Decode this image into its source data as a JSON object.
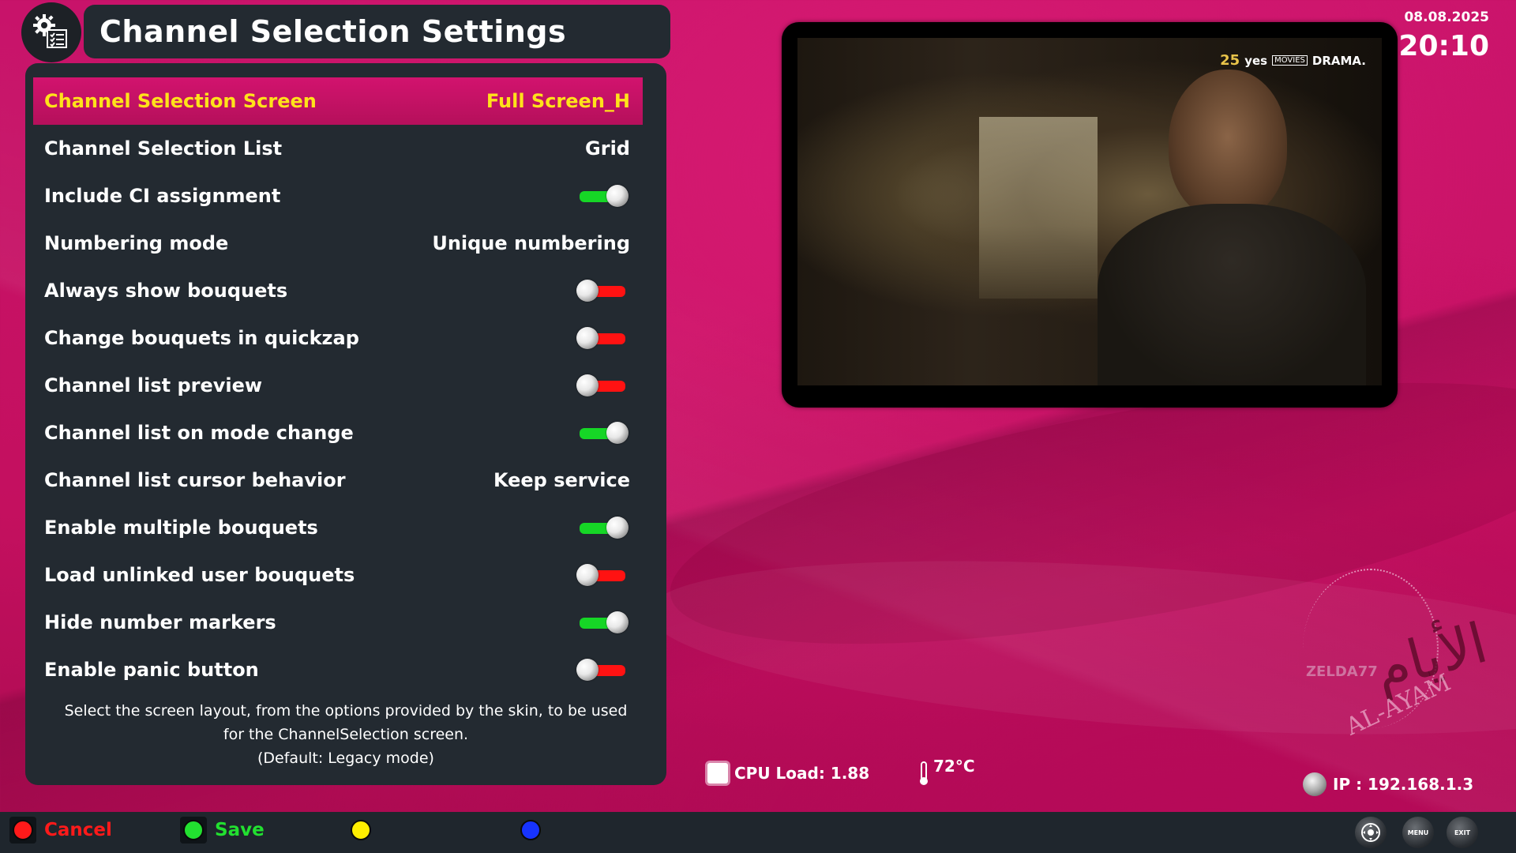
{
  "header": {
    "title": "Channel Selection Settings",
    "icon": "settings-gear-list-icon"
  },
  "settings": [
    {
      "label": "Channel Selection Screen",
      "value": "Full Screen_H",
      "type": "text",
      "selected": true
    },
    {
      "label": "Channel Selection List",
      "value": "Grid",
      "type": "text"
    },
    {
      "label": "Include CI assignment",
      "value": "on",
      "type": "toggle"
    },
    {
      "label": "Numbering mode",
      "value": "Unique numbering",
      "type": "text"
    },
    {
      "label": "Always show bouquets",
      "value": "off",
      "type": "toggle"
    },
    {
      "label": "Change bouquets in quickzap",
      "value": "off",
      "type": "toggle"
    },
    {
      "label": "Channel list preview",
      "value": "off",
      "type": "toggle"
    },
    {
      "label": "Channel list on mode change",
      "value": "on",
      "type": "toggle"
    },
    {
      "label": "Channel list cursor behavior",
      "value": "Keep service",
      "type": "text"
    },
    {
      "label": "Enable multiple bouquets",
      "value": "on",
      "type": "toggle"
    },
    {
      "label": "Load unlinked user bouquets",
      "value": "off",
      "type": "toggle"
    },
    {
      "label": "Hide number markers",
      "value": "on",
      "type": "toggle"
    },
    {
      "label": "Enable panic button",
      "value": "off",
      "type": "toggle"
    }
  ],
  "description": {
    "line1": "Select the screen layout, from the options provided by the skin, to be used",
    "line2": "for the ChannelSelection screen.",
    "line3": "(Default: Legacy mode)"
  },
  "preview": {
    "channel_logo": {
      "num": "25",
      "brand": "yes",
      "box": "MOVIES",
      "name": "DRAMA."
    }
  },
  "clock": {
    "date": "08.08.2025",
    "time": "20:10"
  },
  "watermark": {
    "author": "ZELDA77",
    "brand": "AL-AYAM",
    "arabic": "الأيام"
  },
  "system": {
    "cpu": "CPU Load: 1.88",
    "temperature": "72°C",
    "ip": "IP : 192.168.1.3"
  },
  "buttons": {
    "red": {
      "label": "Cancel",
      "color": "#ff1a1a"
    },
    "green": {
      "label": "Save",
      "color": "#22e030"
    },
    "yellow": {
      "label": "",
      "color": "#ffee00"
    },
    "blue": {
      "label": "",
      "color": "#1733ff"
    },
    "menu": "MENU",
    "exit": "EXIT"
  },
  "colors": {
    "selected_bg": "#c8136a",
    "selected_text": "#ffe21a",
    "panel_bg": "#232a31",
    "toggle_on": "#16d626",
    "toggle_off": "#ff1212"
  }
}
